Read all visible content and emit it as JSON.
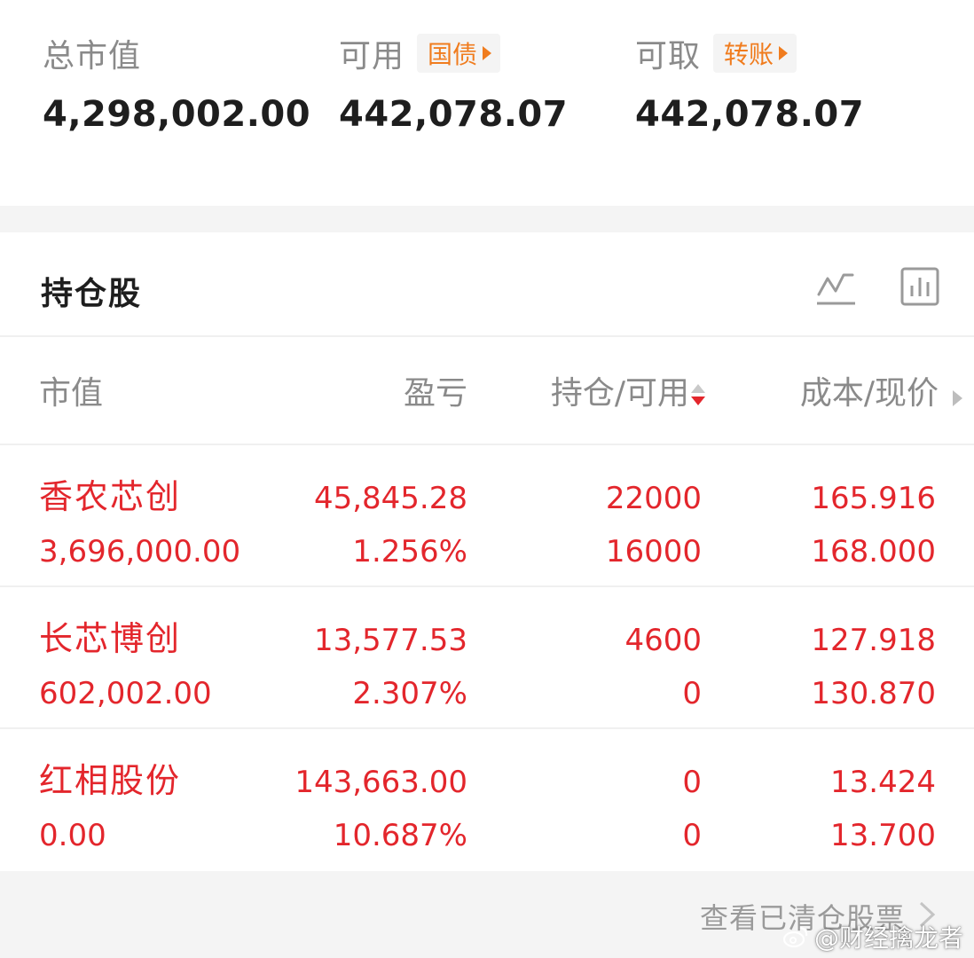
{
  "summary": {
    "total_market_value": {
      "label": "总市值",
      "value": "4,298,002.00"
    },
    "available": {
      "label": "可用",
      "tag": "国债",
      "value": "442,078.07"
    },
    "withdrawable": {
      "label": "可取",
      "tag": "转账",
      "value": "442,078.07"
    }
  },
  "holdings": {
    "title": "持仓股",
    "icons": [
      "line-chart-icon",
      "bar-chart-icon"
    ]
  },
  "columns": {
    "market_value": "市值",
    "profit_loss": "盈亏",
    "position_available": "持仓/可用",
    "cost_price": "成本/现价"
  },
  "rows": [
    {
      "name": "香农芯创",
      "market_value": "3,696,000.00",
      "profit": "45,845.28",
      "profit_pct": "1.256%",
      "position": "22000",
      "available": "16000",
      "cost": "165.916",
      "price": "168.000"
    },
    {
      "name": "长芯博创",
      "market_value": "602,002.00",
      "profit": "13,577.53",
      "profit_pct": "2.307%",
      "position": "4600",
      "available": "0",
      "cost": "127.918",
      "price": "130.870"
    },
    {
      "name": "红相股份",
      "market_value": "0.00",
      "profit": "143,663.00",
      "profit_pct": "10.687%",
      "position": "0",
      "available": "0",
      "cost": "13.424",
      "price": "13.700"
    }
  ],
  "footer": {
    "link": "查看已清仓股票",
    "watermark": "@财经擒龙者"
  },
  "colors": {
    "up_red": "#e3262c",
    "tag_orange": "#f07c1e",
    "muted_text": "#8a8a8a"
  }
}
